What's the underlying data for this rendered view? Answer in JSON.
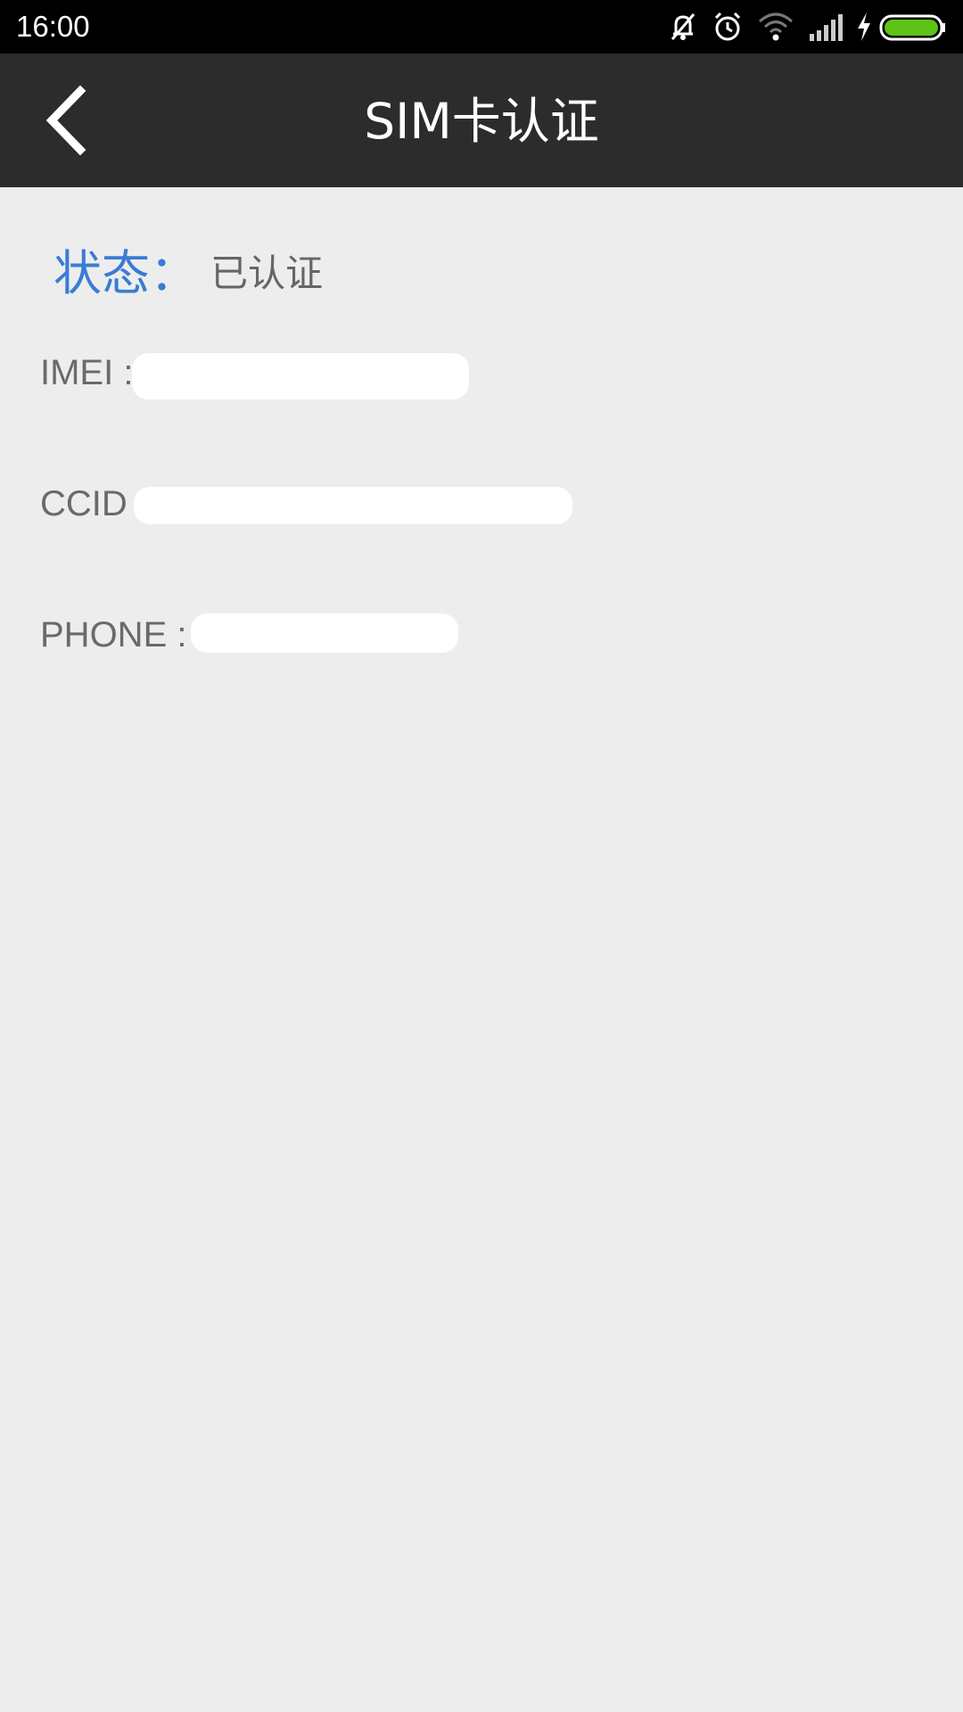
{
  "status_bar": {
    "time": "16:00",
    "icons": [
      "mute-icon",
      "alarm-icon",
      "wifi-icon",
      "signal-icon",
      "charging-icon",
      "battery-icon"
    ],
    "battery_color": "#5ec318"
  },
  "app_bar": {
    "title": "SIM卡认证",
    "back_icon": "chevron-left-icon"
  },
  "content": {
    "status_label": "状态：",
    "status_value": "已认证",
    "imei_label": "IMEI :",
    "ccid_label": "CCID",
    "phone_label": "PHONE :"
  },
  "colors": {
    "status_bar_bg": "#000000",
    "app_bar_bg": "#2c2c2c",
    "page_bg": "#ededed",
    "accent": "#3a7bd5"
  }
}
